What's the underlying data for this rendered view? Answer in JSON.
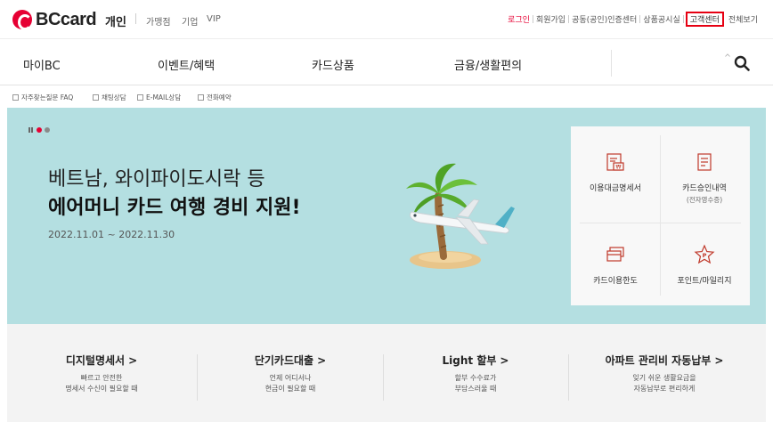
{
  "brand": {
    "logo_text": "BCcard",
    "accent_color": "#e60033",
    "icon": "bc-logo-icon"
  },
  "header": {
    "personal": "개인",
    "links": [
      "가맹점",
      "기업",
      "VIP"
    ]
  },
  "utility": {
    "login": "로그인",
    "signup": "회원가입",
    "certificate": "공동(공인)인증센터",
    "notice": "상품공시실",
    "customer_center": "고객센터",
    "sitemap": "전체보기"
  },
  "main_nav": {
    "items": [
      "마이BC",
      "이벤트/혜택",
      "카드상품",
      "금융/생활편의"
    ],
    "search_icon": "search-icon"
  },
  "quick_links": [
    "자주찾는질문 FAQ",
    "채팅상담",
    "E-MAIL상담",
    "전화예약"
  ],
  "hero": {
    "background": "#b4dfe1",
    "line1": "베트남, 와이파이도시락 등",
    "line2": "에어머니 카드 여행 경비 지원!",
    "period": "2022.11.01 ~ 2022.11.30",
    "slides_active": 1
  },
  "quick_panel": [
    {
      "label": "이용대금명세서",
      "sub": "",
      "icon": "bill-icon"
    },
    {
      "label": "카드승인내역",
      "sub": "(전자영수증)",
      "icon": "receipt-icon"
    },
    {
      "label": "카드이용한도",
      "sub": "",
      "icon": "card-icon"
    },
    {
      "label": "포인트/마일리지",
      "sub": "",
      "icon": "point-star-icon"
    }
  ],
  "services": [
    {
      "title": "디지털명세서",
      "chevron": ">",
      "desc1": "빠르고 안전한",
      "desc2": "명세서 수신이 필요할 때"
    },
    {
      "title": "단기카드대출",
      "chevron": ">",
      "desc1": "언제 어디서나",
      "desc2": "현금이 필요할 때"
    },
    {
      "title": "Light 할부",
      "chevron": ">",
      "desc1": "할부 수수료가",
      "desc2": "부담스러울 때"
    },
    {
      "title": "아파트 관리비 자동납부",
      "chevron": ">",
      "desc1": "잊기 쉬운 생활요금을",
      "desc2": "자동납부로 편리하게"
    }
  ]
}
